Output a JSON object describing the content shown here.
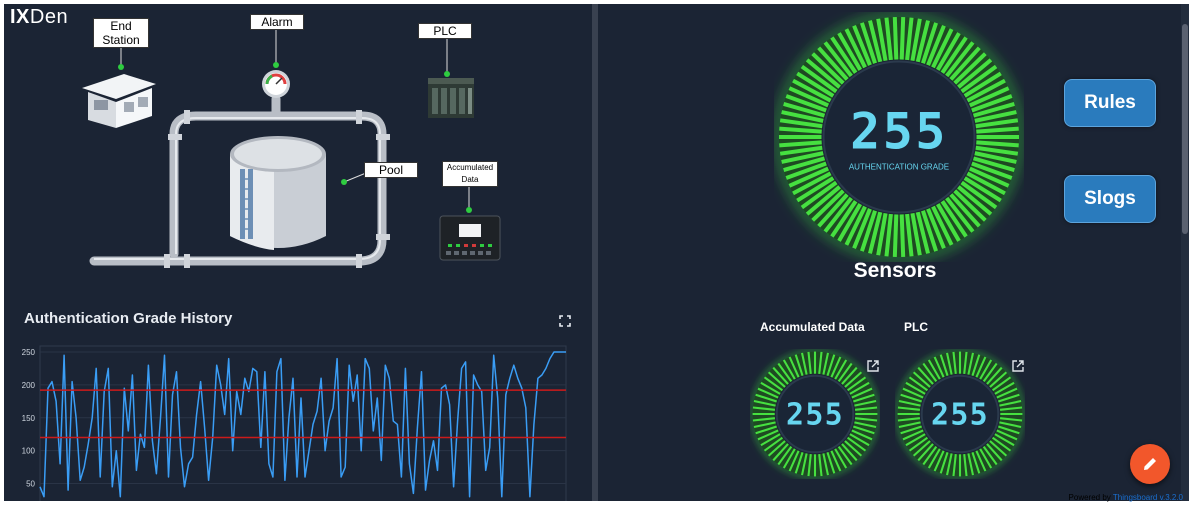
{
  "logo": {
    "bold": "IX",
    "rest": "Den"
  },
  "diagram": {
    "end_station": "End Station",
    "alarm": "Alarm",
    "plc": "PLC",
    "pool": "Pool",
    "accumulated": "Accumulated Data"
  },
  "chart_title": "Authentication Grade History",
  "chart_data": {
    "type": "line",
    "title": "Authentication Grade History",
    "xlabel": "",
    "ylabel": "",
    "ylim": [
      25,
      250
    ],
    "yticks": [
      "250",
      "200",
      "150",
      "100",
      "50"
    ],
    "threshold_lines": [
      192,
      120
    ],
    "series": [
      {
        "values": [
          45,
          30,
          195,
          205,
          175,
          80,
          245,
          40,
          205,
          150,
          55,
          75,
          110,
          150,
          225,
          60,
          190,
          225,
          45,
          100,
          30,
          195,
          130,
          215,
          70,
          125,
          105,
          230,
          115,
          65,
          150,
          245,
          60,
          185,
          220,
          105,
          45,
          80,
          90,
          155,
          205,
          135,
          55,
          120,
          230,
          200,
          155,
          240,
          100,
          190,
          155,
          210,
          190,
          225,
          220,
          105,
          220,
          80,
          60,
          220,
          240,
          55,
          150,
          210,
          60,
          180,
          60,
          100,
          140,
          160,
          210,
          100,
          145,
          165,
          240,
          60,
          75,
          230,
          175,
          215,
          100,
          240,
          225,
          130,
          180,
          85,
          230,
          210,
          145,
          140,
          60,
          225,
          80,
          35,
          135,
          220,
          40,
          85,
          115,
          70,
          195,
          200,
          170,
          45,
          145,
          225,
          235,
          30,
          215,
          200,
          190,
          70,
          105,
          245,
          180,
          30,
          185,
          210,
          230,
          210,
          195,
          165,
          30,
          140,
          210,
          215,
          225,
          240,
          250,
          250,
          250,
          250
        ]
      }
    ]
  },
  "gauge_main": {
    "value": "255",
    "label": "AUTHENTICATION GRADE"
  },
  "buttons": {
    "rules": "Rules",
    "slogs": "Slogs"
  },
  "sensors_title": "Sensors",
  "sensor1": {
    "title": "Accumulated Data",
    "value": "255"
  },
  "sensor2": {
    "title": "PLC",
    "value": "255"
  },
  "powered": {
    "prefix": "Powered by ",
    "link": "Thingsboard v.3.2.0"
  },
  "colors": {
    "accent": "#2a7bbd",
    "gauge": "#46e040",
    "digits": "#67d6f0",
    "fab": "#f2572b",
    "line": "#3a9df5",
    "threshold": "#cc1a1a"
  }
}
